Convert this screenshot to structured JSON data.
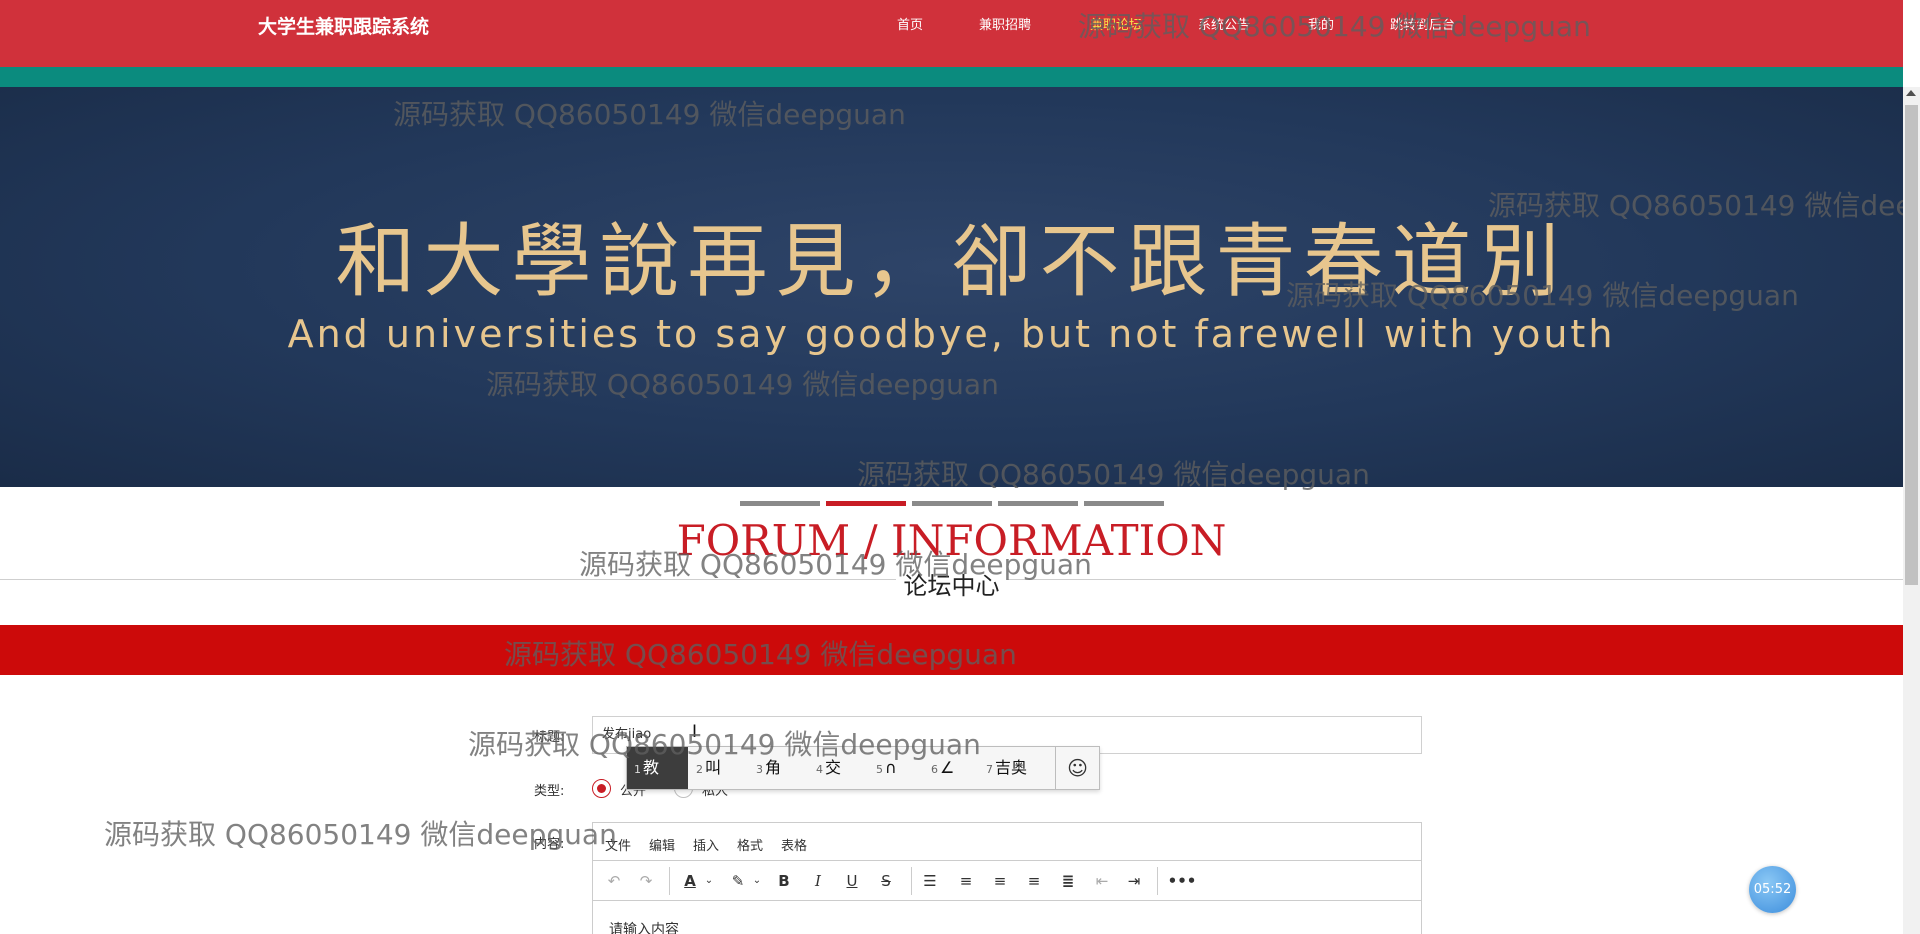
{
  "header": {
    "brand": "大学生兼职跟踪系统",
    "nav": [
      {
        "label": "首页",
        "active": false
      },
      {
        "label": "兼职招聘",
        "active": false
      },
      {
        "label": "兼职论坛",
        "active": true
      },
      {
        "label": "系统公告",
        "active": false
      },
      {
        "label": "我的",
        "active": false
      },
      {
        "label": "跳转到后台",
        "active": false
      }
    ]
  },
  "banner": {
    "title_cn": "和大學說再見，卻不跟青春道別",
    "title_en": "And universities to say goodbye, but not farewell with youth"
  },
  "carousel": {
    "count": 5,
    "active_index": 1
  },
  "section": {
    "title_en": "FORUM / INFORMATION",
    "title_cn": "论坛中心"
  },
  "form": {
    "title_label": "标题:",
    "title_value": "发布jiao",
    "type_label": "类型:",
    "type_options": [
      "公开",
      "私人"
    ],
    "type_selected": 0,
    "content_label": "内容:"
  },
  "ime": {
    "candidates": [
      {
        "num": "1",
        "text": "教"
      },
      {
        "num": "2",
        "text": "叫"
      },
      {
        "num": "3",
        "text": "角"
      },
      {
        "num": "4",
        "text": "交"
      },
      {
        "num": "5",
        "text": "∩"
      },
      {
        "num": "6",
        "text": "∠"
      },
      {
        "num": "7",
        "text": "吉奥"
      }
    ],
    "selected": 0,
    "emoji": "☺"
  },
  "editor": {
    "menu": [
      "文件",
      "编辑",
      "插入",
      "格式",
      "表格"
    ],
    "placeholder": "请输入内容",
    "tools": [
      "undo-icon",
      "redo-icon",
      "font-color-icon",
      "highlight-icon",
      "bold-icon",
      "italic-icon",
      "underline-icon",
      "strikethrough-icon",
      "line-height-icon",
      "align-left-icon",
      "align-center-icon",
      "align-right-icon",
      "align-justify-icon",
      "outdent-icon",
      "indent-icon",
      "more-icon"
    ]
  },
  "watermark": "源码获取 QQ86050149 微信deepguan",
  "clock": "05:52",
  "colors": {
    "header_red": "#d0313b",
    "teal": "#0b8b7e",
    "accent_red": "#c81d25",
    "band_red": "#cc0a0a",
    "nav_active": "#f7e14a",
    "banner_gold": "#e7c68e"
  }
}
